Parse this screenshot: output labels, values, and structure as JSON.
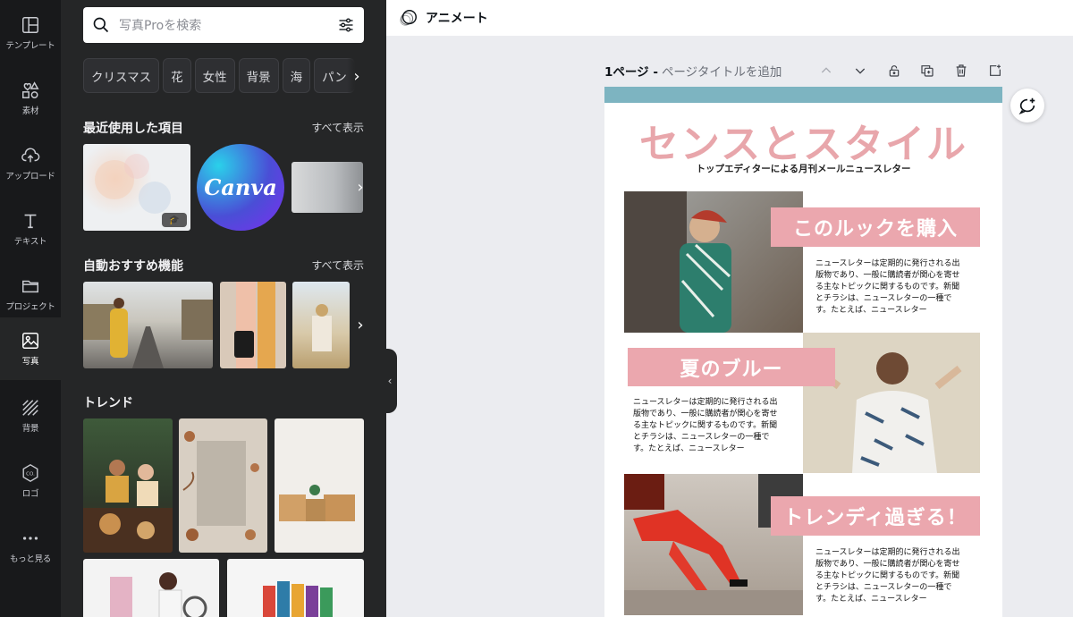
{
  "sidebar": {
    "items": [
      {
        "label": "テンプレート",
        "icon": "template-icon"
      },
      {
        "label": "素材",
        "icon": "elements-icon"
      },
      {
        "label": "アップロード",
        "icon": "upload-icon"
      },
      {
        "label": "テキスト",
        "icon": "text-icon"
      },
      {
        "label": "プロジェクト",
        "icon": "folder-icon"
      },
      {
        "label": "写真",
        "icon": "photo-icon",
        "active": true
      },
      {
        "label": "背景",
        "icon": "background-icon"
      },
      {
        "label": "ロゴ",
        "icon": "logo-icon"
      },
      {
        "label": "もっと見る",
        "icon": "more-icon"
      }
    ]
  },
  "panel": {
    "search_placeholder": "写真Proを検索",
    "chips": [
      "クリスマス",
      "花",
      "女性",
      "背景",
      "海",
      "パン"
    ],
    "recent": {
      "title": "最近使用した項目",
      "link": "すべて表示",
      "canva_logo": "Canva"
    },
    "auto": {
      "title": "自動おすすめ機能",
      "link": "すべて表示"
    },
    "trend": {
      "title": "トレンド"
    }
  },
  "topbar": {
    "animate_label": "アニメート"
  },
  "page_header": {
    "number": "1ページ -",
    "title": "ページタイトルを追加"
  },
  "newsletter": {
    "title": "センスとスタイル",
    "subtitle": "トップエディターによる月刊メールニュースレター",
    "label1": "このルックを購入",
    "label2": "夏のブルー",
    "label3": "トレンディ過ぎる！",
    "body_lines": [
      "ニュースレターは定期的に発行される出",
      "版物であり、一般に購読者が関心を寄せ",
      "る主なトピックに関するものです。新聞",
      "とチラシは、ニュースレターの一種で",
      "す。たとえば、ニュースレター"
    ]
  },
  "colors": {
    "accent_pink": "#eba7ae",
    "band_blue": "#7db4c1",
    "panel_bg": "#252627",
    "rail_bg": "#18191b"
  }
}
